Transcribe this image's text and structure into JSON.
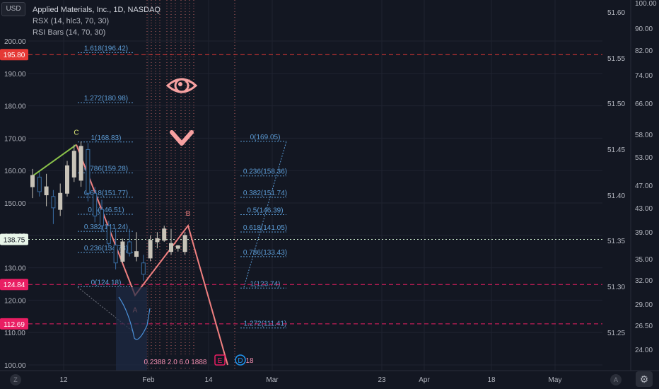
{
  "legend": {
    "title": "Applied Materials, Inc., 1D, NASDAQ",
    "line2": "RSX (14, hlc3, 70, 30)",
    "line3": "RSI Bars (14, 70, 30)"
  },
  "unit_label": "USD",
  "colors": {
    "background": "#131722",
    "grid": "#1f2330",
    "up": "#c8c3b8",
    "down": "#3a6ea5",
    "fib": "#5b9bd5",
    "pattern": "#f08080",
    "rsx": "#4a90d9",
    "current_price": "#26a69a",
    "red_label": "#e53935",
    "magenta_label": "#e91e63",
    "green_line": "#8bc34a"
  },
  "chart_data": {
    "type": "candlestick",
    "title": "Applied Materials, Inc., 1D, NASDAQ",
    "y_left": {
      "ticks": [
        200.0,
        190.0,
        180.0,
        170.0,
        160.0,
        150.0,
        140.0,
        130.0,
        120.0,
        110.0,
        100.0
      ],
      "range": [
        100,
        205
      ]
    },
    "y_mid": {
      "ticks": [
        "51.60",
        "51.55",
        "51.50",
        "51.45",
        "51.40",
        "51.35",
        "51.30",
        "51.25"
      ]
    },
    "y_right": {
      "ticks": [
        "100.00",
        "90.00",
        "82.00",
        "74.00",
        "66.00",
        "58.00",
        "53.00",
        "47.00",
        "43.00",
        "39.00",
        "35.00",
        "32.00",
        "29.00",
        "26.50",
        "24.00"
      ]
    },
    "x_labels": [
      "12",
      "Feb",
      "14",
      "Mar",
      "23",
      "Apr",
      "18",
      "May"
    ],
    "corner_labels": {
      "left": "Z",
      "right": "A"
    },
    "price_labels": [
      {
        "text": "195.80",
        "value": 195.8,
        "kind": "red"
      },
      {
        "text": "138.75",
        "value": 138.75,
        "kind": "current"
      },
      {
        "text": "124.84",
        "value": 124.84,
        "kind": "magenta"
      },
      {
        "text": "112.69",
        "value": 112.69,
        "kind": "magenta"
      }
    ],
    "candles": [
      {
        "o": 155.0,
        "h": 160.5,
        "l": 151.5,
        "c": 158.5
      },
      {
        "o": 158.0,
        "h": 159.5,
        "l": 152.0,
        "c": 153.5
      },
      {
        "o": 152.5,
        "h": 159.0,
        "l": 149.0,
        "c": 155.0
      },
      {
        "o": 152.0,
        "h": 154.0,
        "l": 143.5,
        "c": 148.5
      },
      {
        "o": 148.0,
        "h": 156.0,
        "l": 146.0,
        "c": 153.0
      },
      {
        "o": 153.0,
        "h": 163.0,
        "l": 152.0,
        "c": 161.5
      },
      {
        "o": 158.0,
        "h": 168.0,
        "l": 156.5,
        "c": 166.0
      },
      {
        "o": 157.0,
        "h": 169.0,
        "l": 155.0,
        "c": 167.5
      },
      {
        "o": 166.5,
        "h": 168.5,
        "l": 150.5,
        "c": 153.0
      },
      {
        "o": 153.0,
        "h": 155.0,
        "l": 144.0,
        "c": 146.0
      },
      {
        "o": 148.0,
        "h": 151.0,
        "l": 141.0,
        "c": 143.0
      },
      {
        "o": 143.0,
        "h": 144.5,
        "l": 136.0,
        "c": 137.5
      },
      {
        "o": 137.0,
        "h": 142.0,
        "l": 129.5,
        "c": 131.5
      },
      {
        "o": 132.0,
        "h": 139.0,
        "l": 131.5,
        "c": 138.0
      },
      {
        "o": 138.0,
        "h": 142.0,
        "l": 133.5,
        "c": 134.5
      },
      {
        "o": 133.5,
        "h": 141.0,
        "l": 132.0,
        "c": 135.0
      },
      {
        "o": 131.5,
        "h": 134.0,
        "l": 126.0,
        "c": 128.0
      },
      {
        "o": 133.0,
        "h": 140.0,
        "l": 132.0,
        "c": 138.5
      },
      {
        "o": 138.0,
        "h": 141.0,
        "l": 136.0,
        "c": 139.0
      },
      {
        "o": 138.5,
        "h": 143.0,
        "l": 138.0,
        "c": 142.0
      },
      {
        "o": 135.0,
        "h": 142.0,
        "l": 134.0,
        "c": 137.5
      },
      {
        "o": 136.0,
        "h": 137.0,
        "l": 135.0,
        "c": 136.8
      },
      {
        "o": 135.0,
        "h": 141.0,
        "l": 134.0,
        "c": 140.0
      }
    ],
    "fib_left": [
      {
        "label": "1.618(196.42)",
        "value": 196.42
      },
      {
        "label": "1.272(180.98)",
        "value": 180.98
      },
      {
        "label": "1(168.83)",
        "value": 168.83
      },
      {
        "label": "0.786(159.28)",
        "value": 159.28
      },
      {
        "label": "0.618(151.77)",
        "value": 151.77
      },
      {
        "label": "0.5(146.51)",
        "value": 146.51
      },
      {
        "label": "0.382(141.24)",
        "value": 141.24
      },
      {
        "label": "0.236(134.73)",
        "value": 134.73
      },
      {
        "label": "0(124.18)",
        "value": 124.18
      }
    ],
    "fib_right": [
      {
        "label": "0(169.05)",
        "value": 169.05
      },
      {
        "label": "0.236(158.36)",
        "value": 158.36
      },
      {
        "label": "0.382(151.74)",
        "value": 151.74
      },
      {
        "label": "0.5(146.39)",
        "value": 146.39
      },
      {
        "label": "0.618(141.05)",
        "value": 141.05
      },
      {
        "label": "0.786(133.43)",
        "value": 133.43
      },
      {
        "label": "1(123.74)",
        "value": 123.74
      },
      {
        "label": "1.272(111.41)",
        "value": 111.41
      }
    ],
    "pattern_points": [
      {
        "label": "C",
        "value": 168.0
      },
      {
        "label": "A",
        "value": 121.5
      },
      {
        "label": "B",
        "value": 143.0
      }
    ],
    "dashed_levels": [
      195.8,
      124.84,
      112.69
    ],
    "current_price": 138.75,
    "bottom_markers": {
      "e": "E",
      "d": "D",
      "d_count": "18",
      "fib_time_text": "0.2388 2.0 6.0 1888"
    }
  }
}
